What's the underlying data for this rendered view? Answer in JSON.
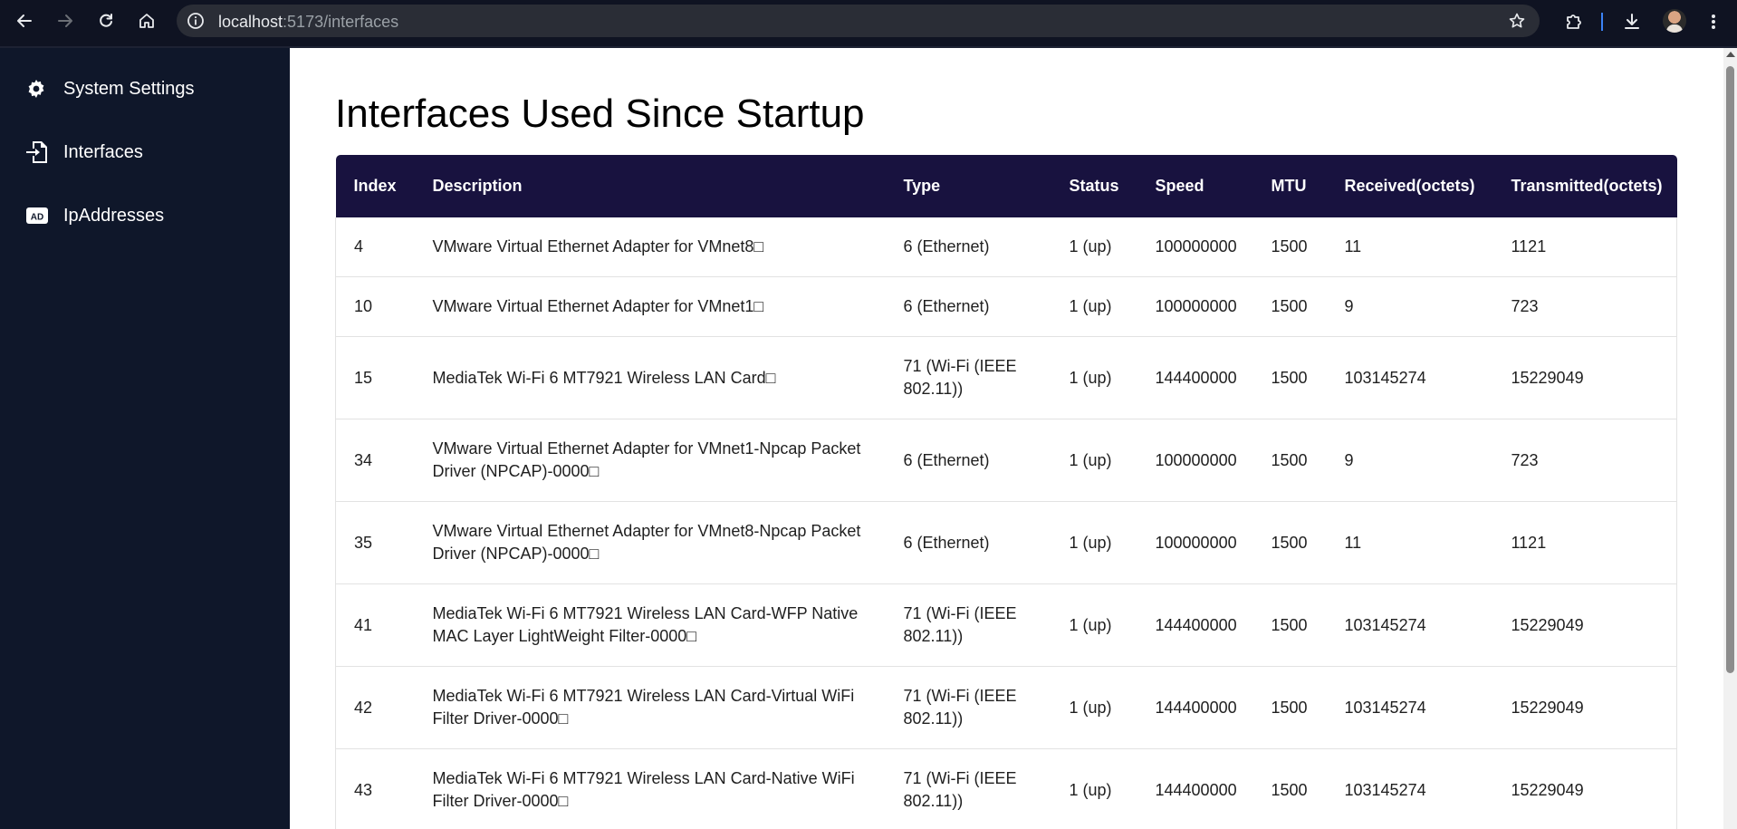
{
  "browser": {
    "url_host": "localhost",
    "url_path": ":5173/interfaces"
  },
  "sidebar": {
    "items": [
      {
        "label": "System Settings",
        "icon": "gear-icon"
      },
      {
        "label": "Interfaces",
        "icon": "file-import-icon"
      },
      {
        "label": "IpAddresses",
        "icon": "ad-badge-icon"
      }
    ]
  },
  "main": {
    "title": "Interfaces Used Since Startup",
    "table": {
      "headers": [
        "Index",
        "Description",
        "Type",
        "Status",
        "Speed",
        "MTU",
        "Received(octets)",
        "Transmitted(octets)"
      ],
      "rows": [
        [
          "4",
          "VMware Virtual Ethernet Adapter for VMnet8□",
          "6 (Ethernet)",
          "1 (up)",
          "100000000",
          "1500",
          "11",
          "1121"
        ],
        [
          "10",
          "VMware Virtual Ethernet Adapter for VMnet1□",
          "6 (Ethernet)",
          "1 (up)",
          "100000000",
          "1500",
          "9",
          "723"
        ],
        [
          "15",
          "MediaTek Wi-Fi 6 MT7921 Wireless LAN Card□",
          "71 (Wi-Fi (IEEE 802.11))",
          "1 (up)",
          "144400000",
          "1500",
          "103145274",
          "15229049"
        ],
        [
          "34",
          "VMware Virtual Ethernet Adapter for VMnet1-Npcap Packet Driver (NPCAP)-0000□",
          "6 (Ethernet)",
          "1 (up)",
          "100000000",
          "1500",
          "9",
          "723"
        ],
        [
          "35",
          "VMware Virtual Ethernet Adapter for VMnet8-Npcap Packet Driver (NPCAP)-0000□",
          "6 (Ethernet)",
          "1 (up)",
          "100000000",
          "1500",
          "11",
          "1121"
        ],
        [
          "41",
          "MediaTek Wi-Fi 6 MT7921 Wireless LAN Card-WFP Native MAC Layer LightWeight Filter-0000□",
          "71 (Wi-Fi (IEEE 802.11))",
          "1 (up)",
          "144400000",
          "1500",
          "103145274",
          "15229049"
        ],
        [
          "42",
          "MediaTek Wi-Fi 6 MT7921 Wireless LAN Card-Virtual WiFi Filter Driver-0000□",
          "71 (Wi-Fi (IEEE 802.11))",
          "1 (up)",
          "144400000",
          "1500",
          "103145274",
          "15229049"
        ],
        [
          "43",
          "MediaTek Wi-Fi 6 MT7921 Wireless LAN Card-Native WiFi Filter Driver-0000□",
          "71 (Wi-Fi (IEEE 802.11))",
          "1 (up)",
          "144400000",
          "1500",
          "103145274",
          "15229049"
        ]
      ]
    }
  },
  "colors": {
    "sidebar_bg": "#0f172a",
    "table_header_bg": "#18123f",
    "chrome_bg": "#0f1322"
  }
}
